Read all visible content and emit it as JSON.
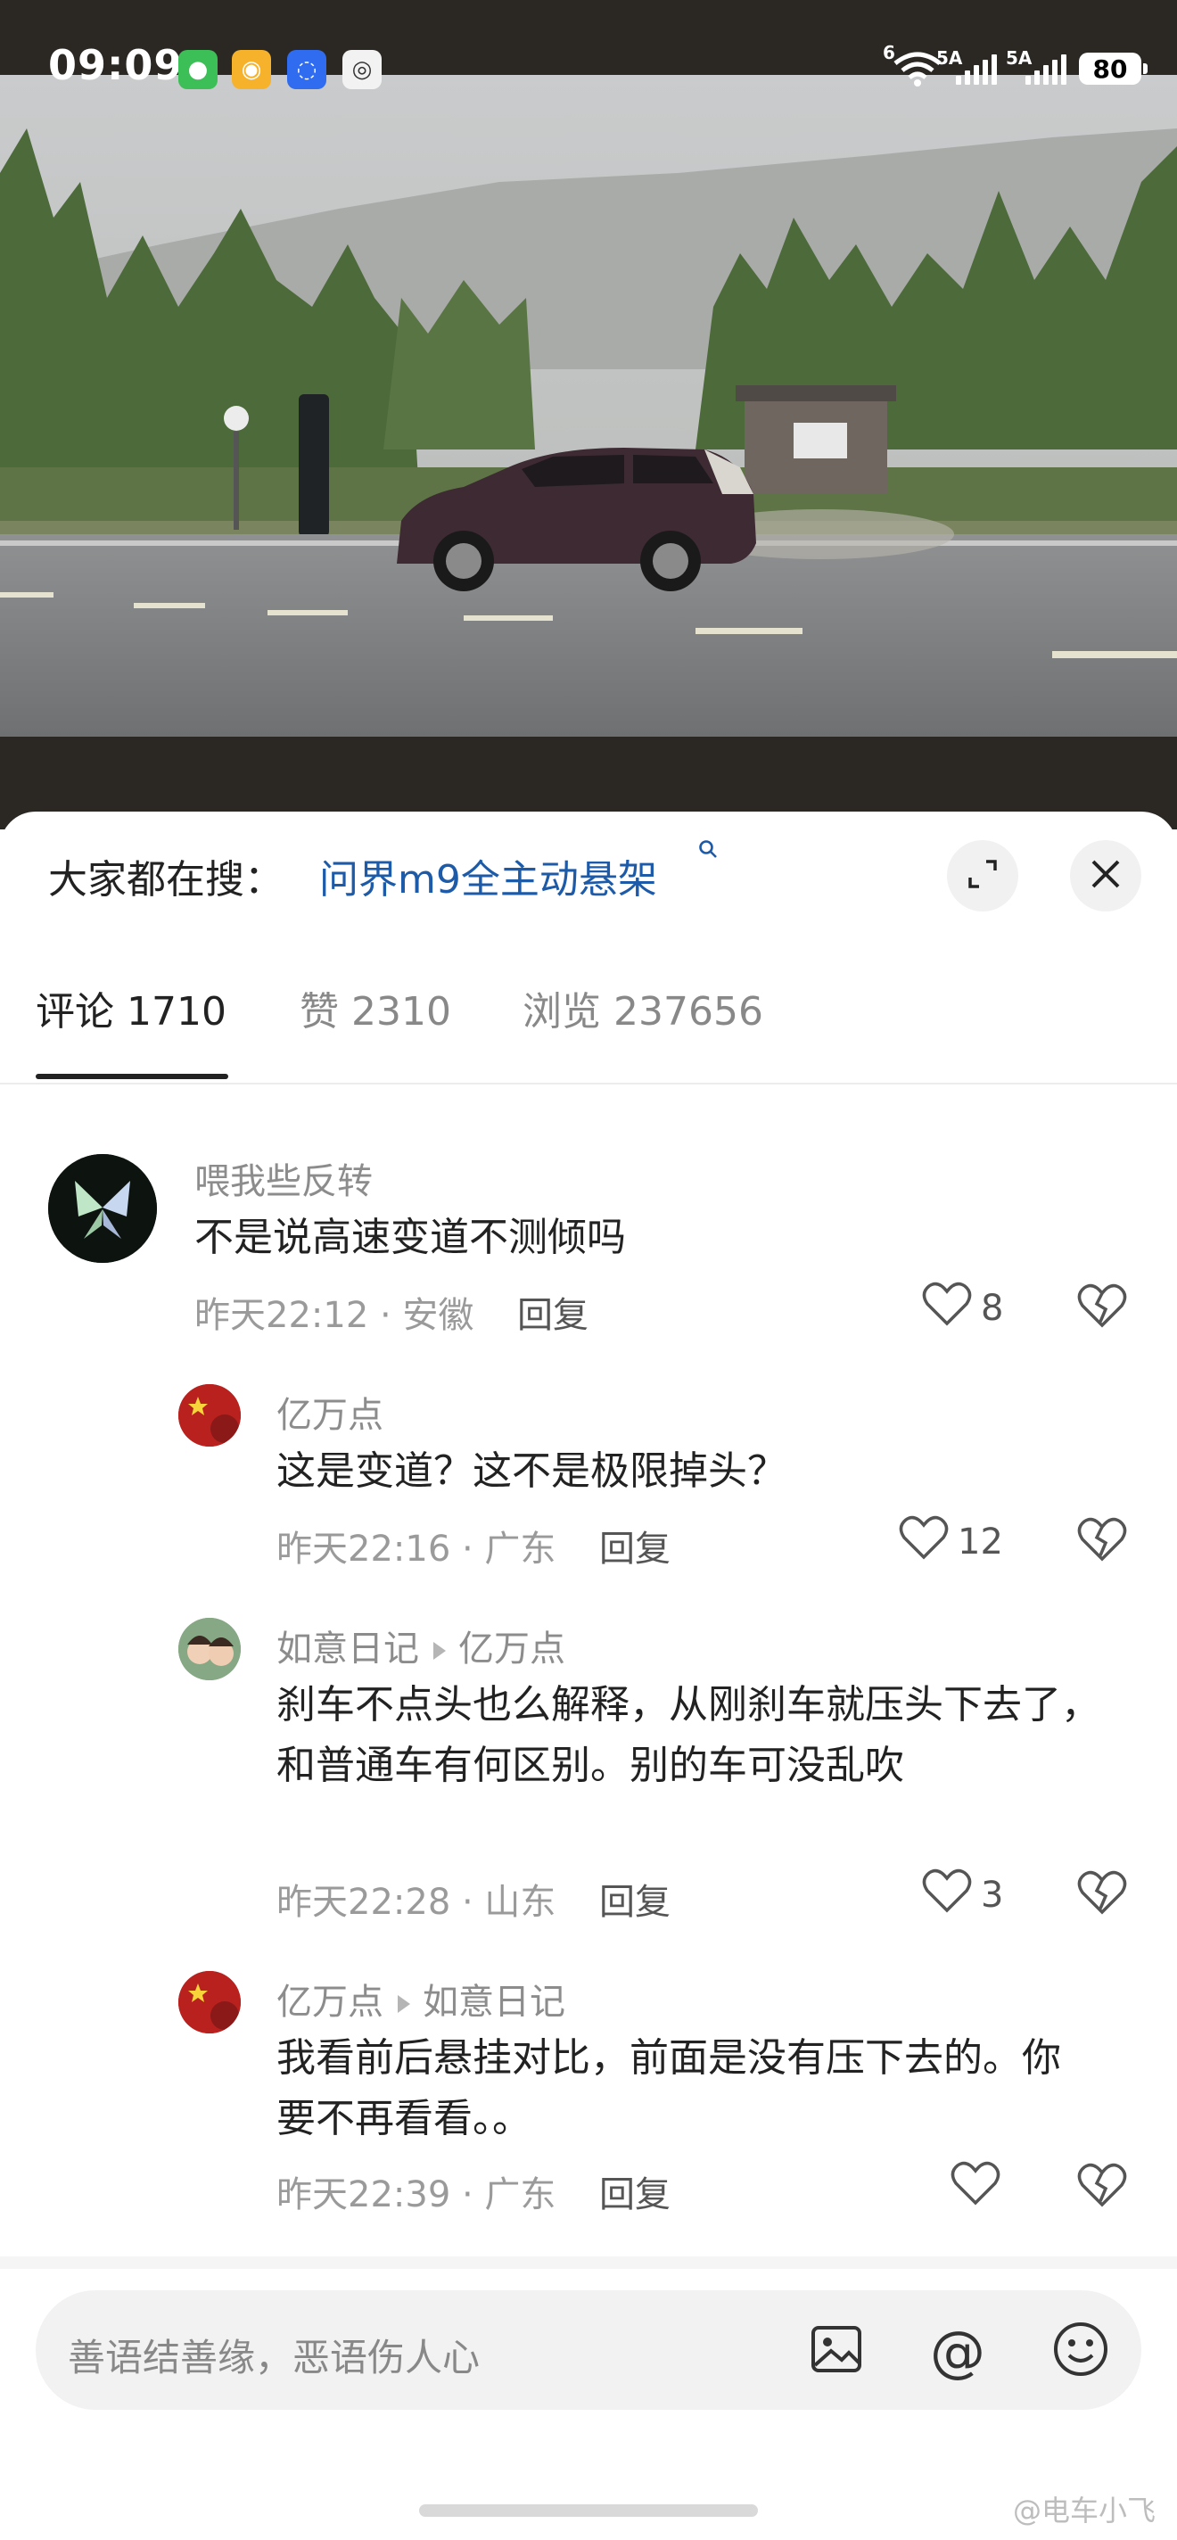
{
  "status_bar": {
    "time": "09:09",
    "apps": [
      "wechat-icon",
      "weibo-icon",
      "bulb-app-icon",
      "camera-app-icon"
    ],
    "network_tag": "6",
    "sim1": "5A",
    "sim2": "5A",
    "battery": "80"
  },
  "search": {
    "prefix": "大家都在搜：",
    "term": "问界m9全主动悬架"
  },
  "tabs": [
    {
      "label": "评论 1710",
      "active": true
    },
    {
      "label": "赞 2310",
      "active": false
    },
    {
      "label": "浏览 237656",
      "active": false
    }
  ],
  "comments": [
    {
      "user": "喂我些反转",
      "reply_to": "",
      "text": "不是说高速变道不测倾吗",
      "time_loc": "昨天22:12 · 安徽",
      "reply_label": "回复",
      "likes": "8"
    },
    {
      "user": "亿万点",
      "reply_to": "",
      "text": "这是变道？这不是极限掉头？",
      "time_loc": "昨天22:16 · 广东",
      "reply_label": "回复",
      "likes": "12"
    },
    {
      "user": "如意日记",
      "reply_to": "亿万点",
      "text": "刹车不点头也么解释，从刚刹车就压头下去了，和普通车有何区别。别的车可没乱吹",
      "time_loc": "昨天22:28 · 山东",
      "reply_label": "回复",
      "likes": "3"
    },
    {
      "user": "亿万点",
      "reply_to": "如意日记",
      "text": "我看前后悬挂对比，前面是没有压下去的。你要不再看看。。",
      "time_loc": "昨天22:39 · 广东",
      "reply_label": "回复",
      "likes": ""
    }
  ],
  "input": {
    "placeholder": "善语结善缘，恶语伤人心"
  },
  "watermark": "@电车小飞",
  "colors": {
    "accent_link": "#1d5aa7",
    "muted_text": "#8c8c8c",
    "sheet_bg": "#ffffff"
  }
}
